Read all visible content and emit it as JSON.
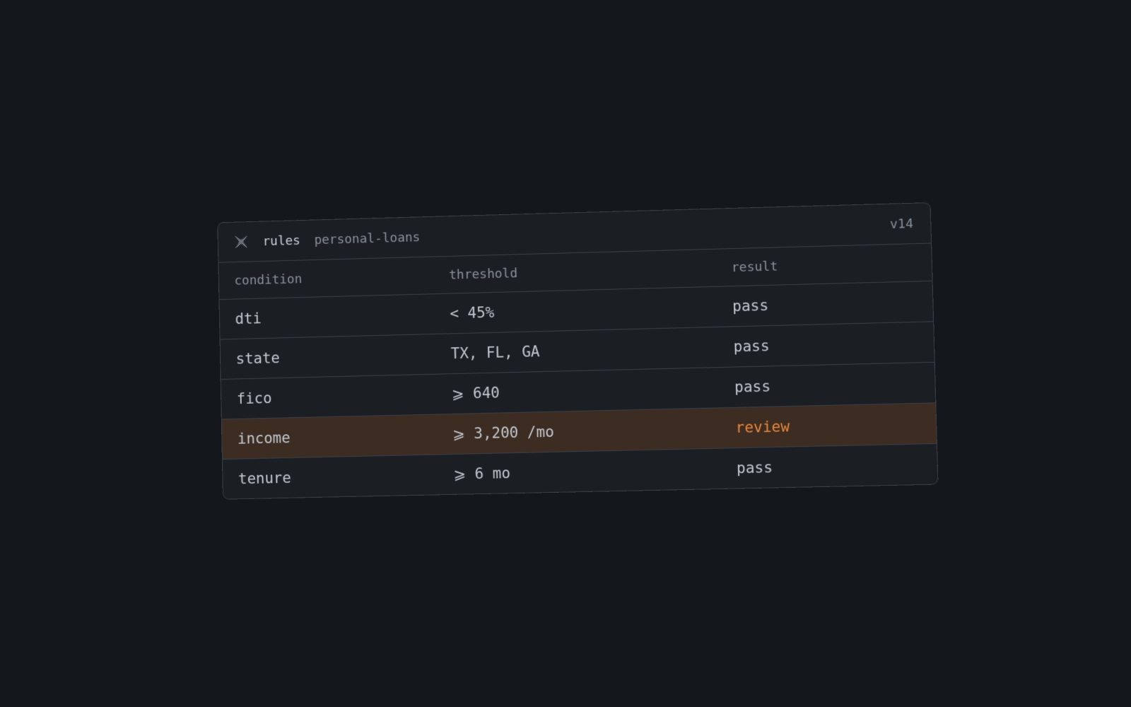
{
  "header": {
    "app_name": "rules",
    "ruleset": "personal-loans",
    "version": "v14",
    "logo_icon": "crosshatch-logo-icon"
  },
  "columns": {
    "condition": "condition",
    "threshold": "threshold",
    "result": "result"
  },
  "rows": [
    {
      "condition": "dti",
      "threshold": "< 45%",
      "result": "pass",
      "flagged": false
    },
    {
      "condition": "state",
      "threshold": "TX, FL, GA",
      "result": "pass",
      "flagged": false
    },
    {
      "condition": "fico",
      "threshold": "⩾ 640",
      "result": "pass",
      "flagged": false
    },
    {
      "condition": "income",
      "threshold": "⩾ 3,200 /mo",
      "result": "review",
      "flagged": true
    },
    {
      "condition": "tenure",
      "threshold": "⩾ 6 mo",
      "result": "pass",
      "flagged": false
    }
  ],
  "colors": {
    "background": "#14181c",
    "card": "#1b1f24",
    "border": "#3a4048",
    "flagged_row": "#3c2c22",
    "review_accent": "#e8863a"
  }
}
